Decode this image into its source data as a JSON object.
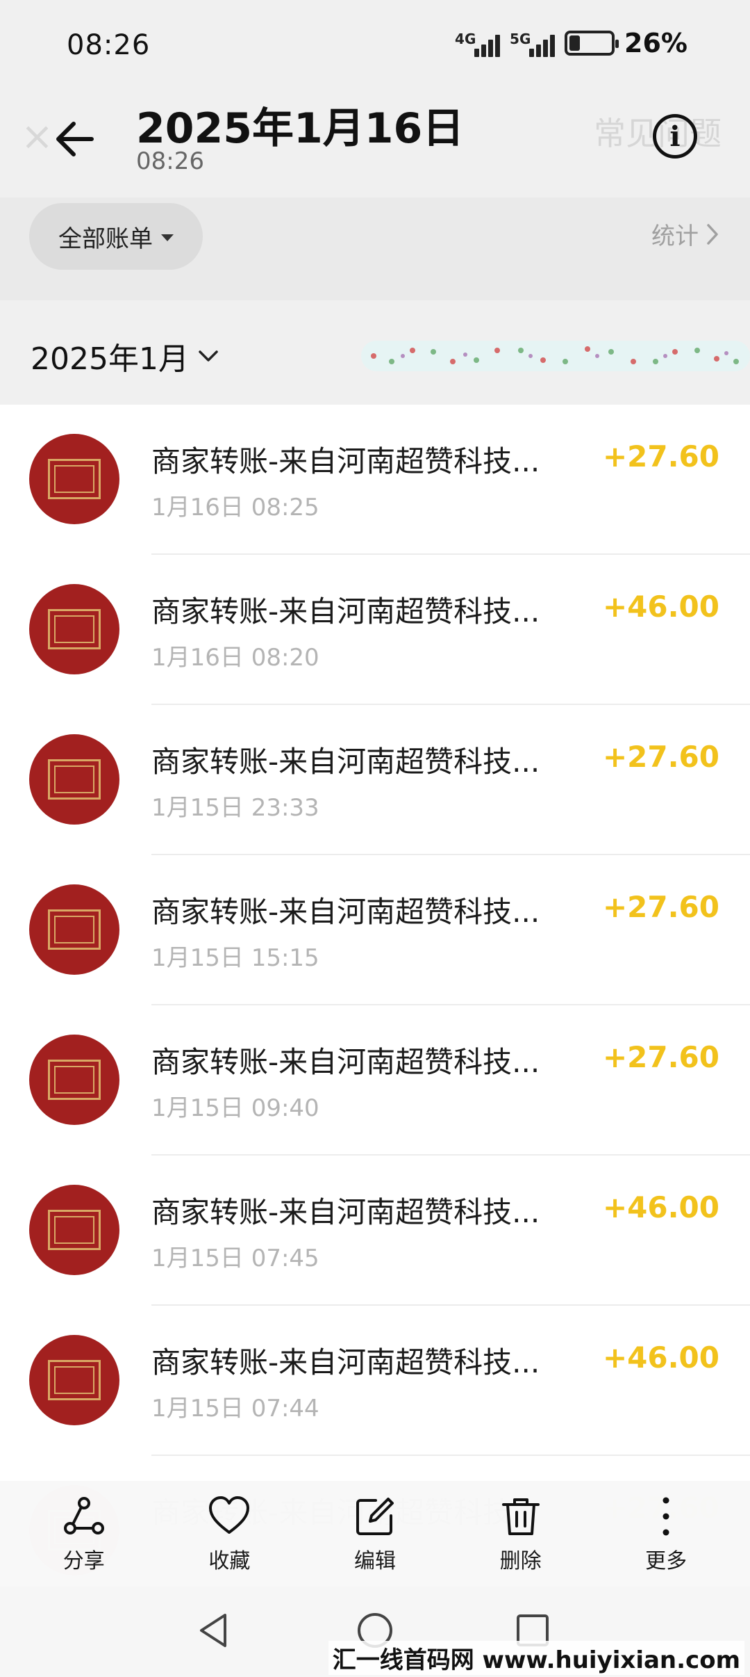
{
  "status_bar": {
    "time": "08:26",
    "signal_1_label": "4G",
    "signal_2_label": "5G",
    "battery_percent": "26%",
    "battery_level": 0.26
  },
  "header": {
    "title": "2025年1月16日",
    "subtitle": "08:26",
    "background_close_label": "×",
    "background_faq_label": "常见问题",
    "back_icon": "arrow-left-icon",
    "info_icon": "info-icon",
    "info_label": "i"
  },
  "filter": {
    "chip_label": "全部账单",
    "stats_label": "统计"
  },
  "month": {
    "label": "2025年1月"
  },
  "transactions": [
    {
      "title": "商家转账-来自河南超赞科技...",
      "time": "1月16日 08:25",
      "amount": "+27.60"
    },
    {
      "title": "商家转账-来自河南超赞科技...",
      "time": "1月16日 08:20",
      "amount": "+46.00"
    },
    {
      "title": "商家转账-来自河南超赞科技...",
      "time": "1月15日 23:33",
      "amount": "+27.60"
    },
    {
      "title": "商家转账-来自河南超赞科技...",
      "time": "1月15日 15:15",
      "amount": "+27.60"
    },
    {
      "title": "商家转账-来自河南超赞科技...",
      "time": "1月15日 09:40",
      "amount": "+27.60"
    },
    {
      "title": "商家转账-来自河南超赞科技...",
      "time": "1月15日 07:45",
      "amount": "+46.00"
    },
    {
      "title": "商家转账-来自河南超赞科技...",
      "time": "1月15日 07:44",
      "amount": "+46.00"
    },
    {
      "title": "商家转账-来自河南超赞科技...",
      "time": "",
      "amount": "+27.60"
    }
  ],
  "toolbar": {
    "share": "分享",
    "favorite": "收藏",
    "edit": "编辑",
    "delete": "删除",
    "more": "更多"
  },
  "watermark": "汇一线首码网 www.huiyixian.com",
  "colors": {
    "amount": "#f2c21c",
    "avatar": "#a2201f",
    "header_bg": "#f0f0f0"
  }
}
